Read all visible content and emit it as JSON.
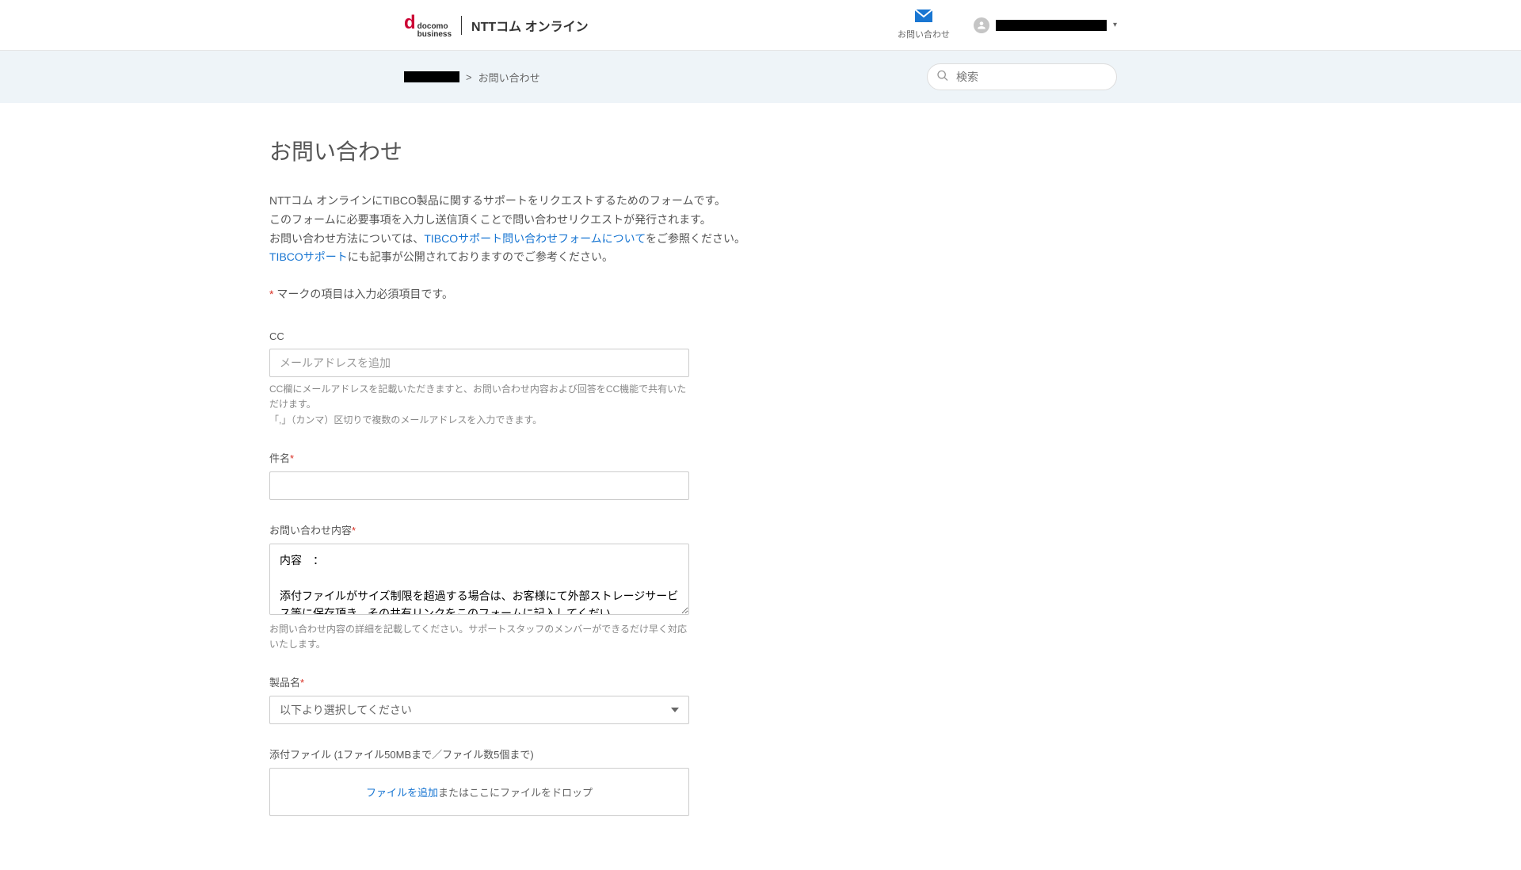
{
  "header": {
    "logo_docomo": "docomo",
    "logo_business": "business",
    "logo_ntt": "NTTコム オンライン",
    "contact_label": "お問い合わせ"
  },
  "subheader": {
    "breadcrumb_separator": ">",
    "breadcrumb_current": "お問い合わせ",
    "search_placeholder": "検索"
  },
  "main": {
    "title": "お問い合わせ",
    "intro_line1": "NTTコム オンラインにTIBCO製品に関するサポートをリクエストするためのフォームです。",
    "intro_line2": "このフォームに必要事項を入力し送信頂くことで問い合わせリクエストが発行されます。",
    "intro_line3_prefix": "お問い合わせ方法については、",
    "intro_link1": "TIBCOサポート問い合わせフォームについて",
    "intro_line3_suffix": "をご参照ください。",
    "intro_link2": "TIBCOサポート",
    "intro_line4_suffix": "にも記事が公開されておりますのでご参考ください。",
    "required_note": " マークの項目は入力必須項目です。",
    "required_star": "*"
  },
  "form": {
    "cc_label": "CC",
    "cc_placeholder": "メールアドレスを追加",
    "cc_hint1": "CC欄にメールアドレスを記載いただきますと、お問い合わせ内容および回答をCC機能で共有いただけます。",
    "cc_hint2": "「,」（カンマ）区切りで複数のメールアドレスを入力できます。",
    "subject_label": "件名",
    "content_label": "お問い合わせ内容",
    "content_value": "内容　：\n\n添付ファイルがサイズ制限を超過する場合は、お客様にて外部ストレージサービス等に保存頂き、その共有リンクをこのフォームに記入してくだい。",
    "content_hint": "お問い合わせ内容の詳細を記載してください。サポートスタッフのメンバーができるだけ早く対応いたします。",
    "product_label": "製品名",
    "product_placeholder": "以下より選択してください",
    "attachment_label": "添付ファイル (1ファイル50MBまで／ファイル数5個まで)",
    "dropzone_link": "ファイルを追加",
    "dropzone_text": "またはここにファイルをドロップ"
  }
}
